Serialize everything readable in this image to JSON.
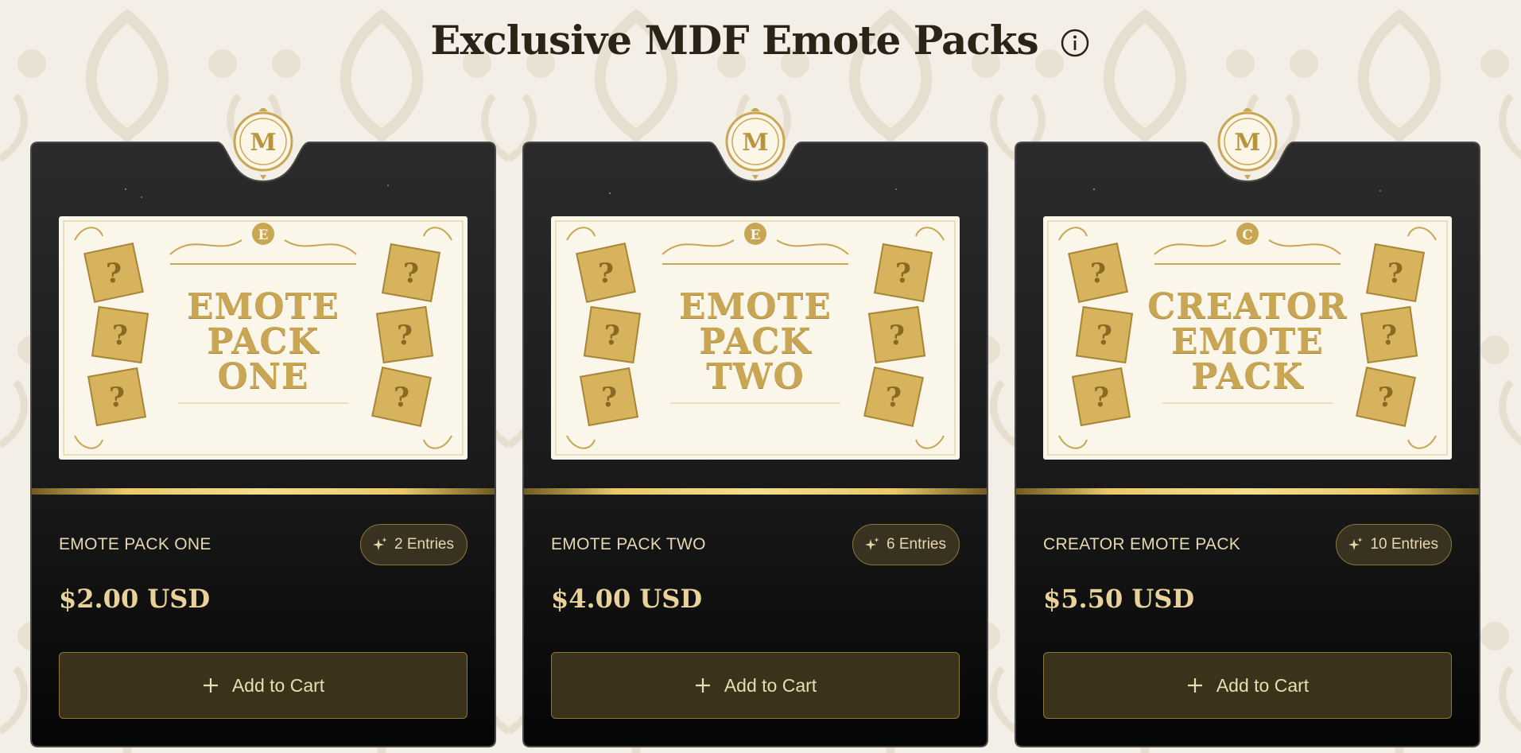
{
  "header": {
    "title": "Exclusive MDF Emote Packs",
    "info_icon": "info-icon"
  },
  "colors": {
    "page_bg": "#f3efe6",
    "card_bg": "#0d0d0d",
    "gold": "#c9a653",
    "button_bg": "#3b321c"
  },
  "cards": [
    {
      "medallion_letter": "M",
      "crest_letter": "E",
      "art_title": [
        "EMOTE",
        "PACK",
        "ONE"
      ],
      "name": "EMOTE PACK ONE",
      "entries": "2 Entries",
      "price": "$2.00 USD",
      "button_label": "Add to Cart"
    },
    {
      "medallion_letter": "M",
      "crest_letter": "E",
      "art_title": [
        "EMOTE",
        "PACK",
        "TWO"
      ],
      "name": "EMOTE PACK TWO",
      "entries": "6 Entries",
      "price": "$4.00 USD",
      "button_label": "Add to Cart"
    },
    {
      "medallion_letter": "M",
      "crest_letter": "C",
      "art_title": [
        "CREATOR",
        "EMOTE",
        "PACK"
      ],
      "name": "CREATOR EMOTE PACK",
      "entries": "10 Entries",
      "price": "$5.50 USD",
      "button_label": "Add to Cart"
    }
  ]
}
